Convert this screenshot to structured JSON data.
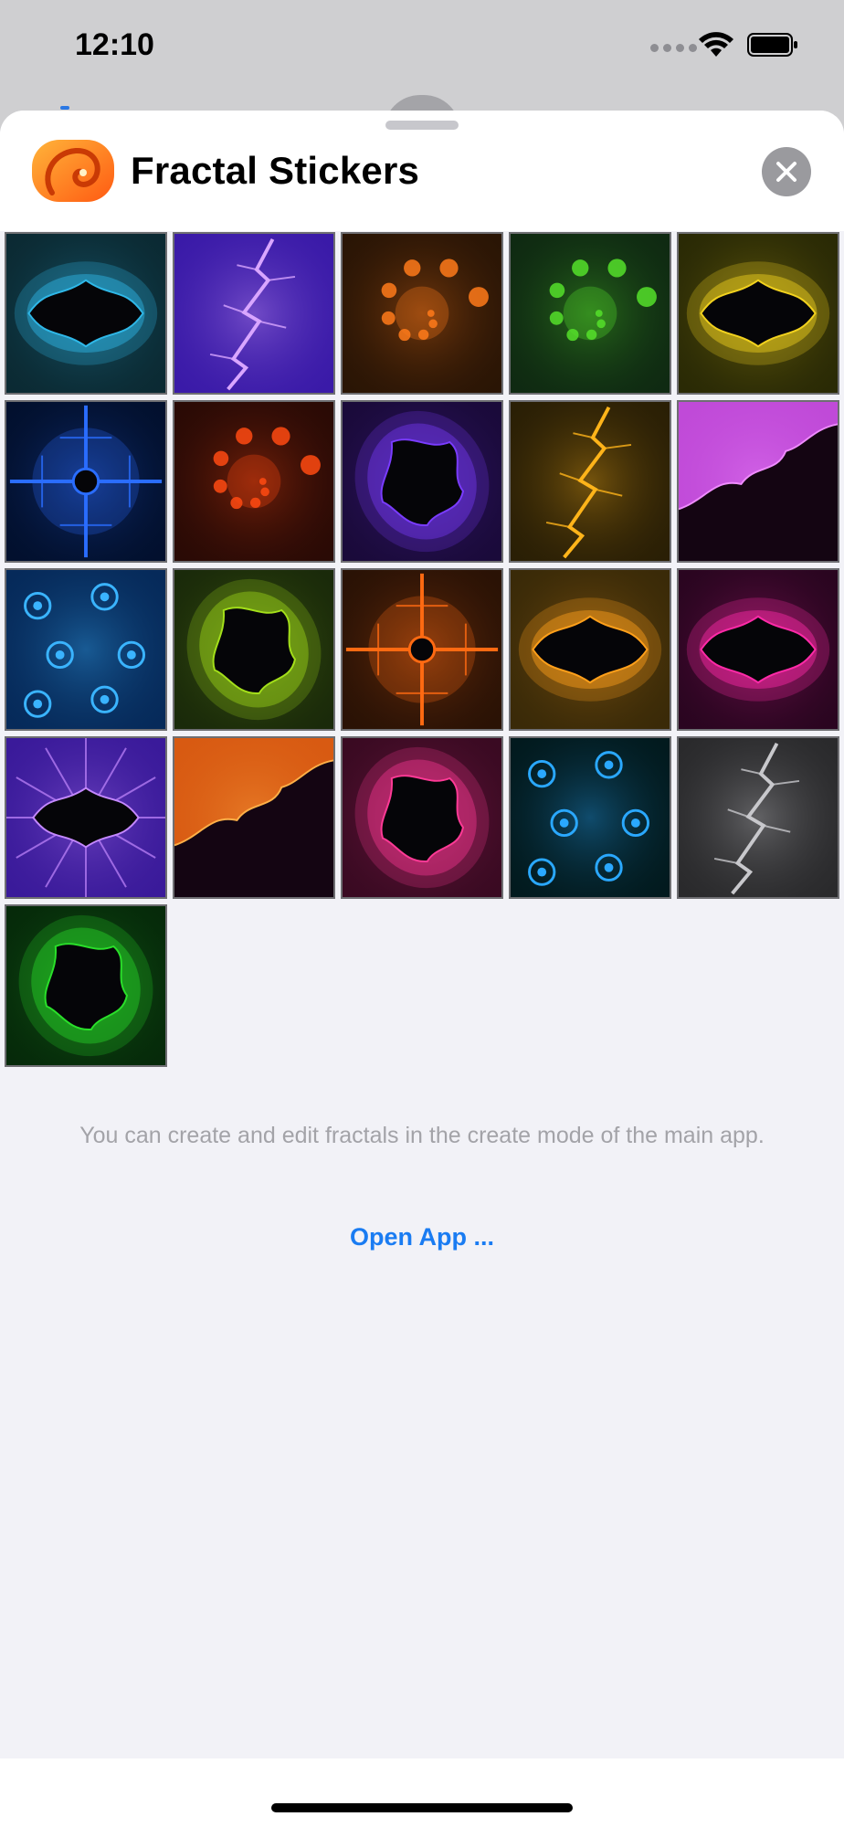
{
  "status_bar": {
    "time": "12:10"
  },
  "sheet": {
    "title": "Fractal Stickers",
    "info_text": "You can create and edit fractals in the create mode of the main app.",
    "open_app_label": "Open App ..."
  },
  "stickers": [
    {
      "name": "sticker-1",
      "theme": "cyan-mandelbrot",
      "bg": "#0b2a33",
      "glow": "#2fb8e8"
    },
    {
      "name": "sticker-2",
      "theme": "violet-lightning",
      "bg": "#3a1aa8",
      "glow": "#d9a6ff"
    },
    {
      "name": "sticker-3",
      "theme": "orange-spiral",
      "bg": "#2a1505",
      "glow": "#ff7a1a"
    },
    {
      "name": "sticker-4",
      "theme": "green-spiral",
      "bg": "#0f2a12",
      "glow": "#55e02a"
    },
    {
      "name": "sticker-5",
      "theme": "yellow-mandelbrot",
      "bg": "#2a2a05",
      "glow": "#f2d21e"
    },
    {
      "name": "sticker-6",
      "theme": "blue-cross",
      "bg": "#02102e",
      "glow": "#2a6dff"
    },
    {
      "name": "sticker-7",
      "theme": "red-spiral",
      "bg": "#2a0a05",
      "glow": "#ff4a12"
    },
    {
      "name": "sticker-8",
      "theme": "purple-blob",
      "bg": "#1a0a3a",
      "glow": "#7a3cff"
    },
    {
      "name": "sticker-9",
      "theme": "gold-dendrite",
      "bg": "#2a1f05",
      "glow": "#ffb41a"
    },
    {
      "name": "sticker-10",
      "theme": "magenta-coast",
      "bg": "#c04ad8",
      "glow": "#f08cff"
    },
    {
      "name": "sticker-11",
      "theme": "blue-seahorses",
      "bg": "#062a5a",
      "glow": "#3ab4ff"
    },
    {
      "name": "sticker-12",
      "theme": "lime-blob",
      "bg": "#1a2a0a",
      "glow": "#a4e01a"
    },
    {
      "name": "sticker-13",
      "theme": "orange-cross",
      "bg": "#2a1205",
      "glow": "#ff6a12"
    },
    {
      "name": "sticker-14",
      "theme": "amber-mandelbrot",
      "bg": "#3a2a08",
      "glow": "#ffa01a"
    },
    {
      "name": "sticker-15",
      "theme": "pink-mandelbrot",
      "bg": "#2a0520",
      "glow": "#ff2aa8"
    },
    {
      "name": "sticker-16",
      "theme": "violet-rays",
      "bg": "#3a1a9a",
      "glow": "#c488ff"
    },
    {
      "name": "sticker-17",
      "theme": "orange-coast",
      "bg": "#d85a12",
      "glow": "#ffb048"
    },
    {
      "name": "sticker-18",
      "theme": "pink-blob",
      "bg": "#3a0a22",
      "glow": "#ff3a96"
    },
    {
      "name": "sticker-19",
      "theme": "teal-seahorses",
      "bg": "#021a1e",
      "glow": "#2aa8ff"
    },
    {
      "name": "sticker-20",
      "theme": "grey-dendrite",
      "bg": "#2a2a2c",
      "glow": "#c8c8cc"
    },
    {
      "name": "sticker-21",
      "theme": "green-blob",
      "bg": "#062a0a",
      "glow": "#2ae02a"
    }
  ]
}
